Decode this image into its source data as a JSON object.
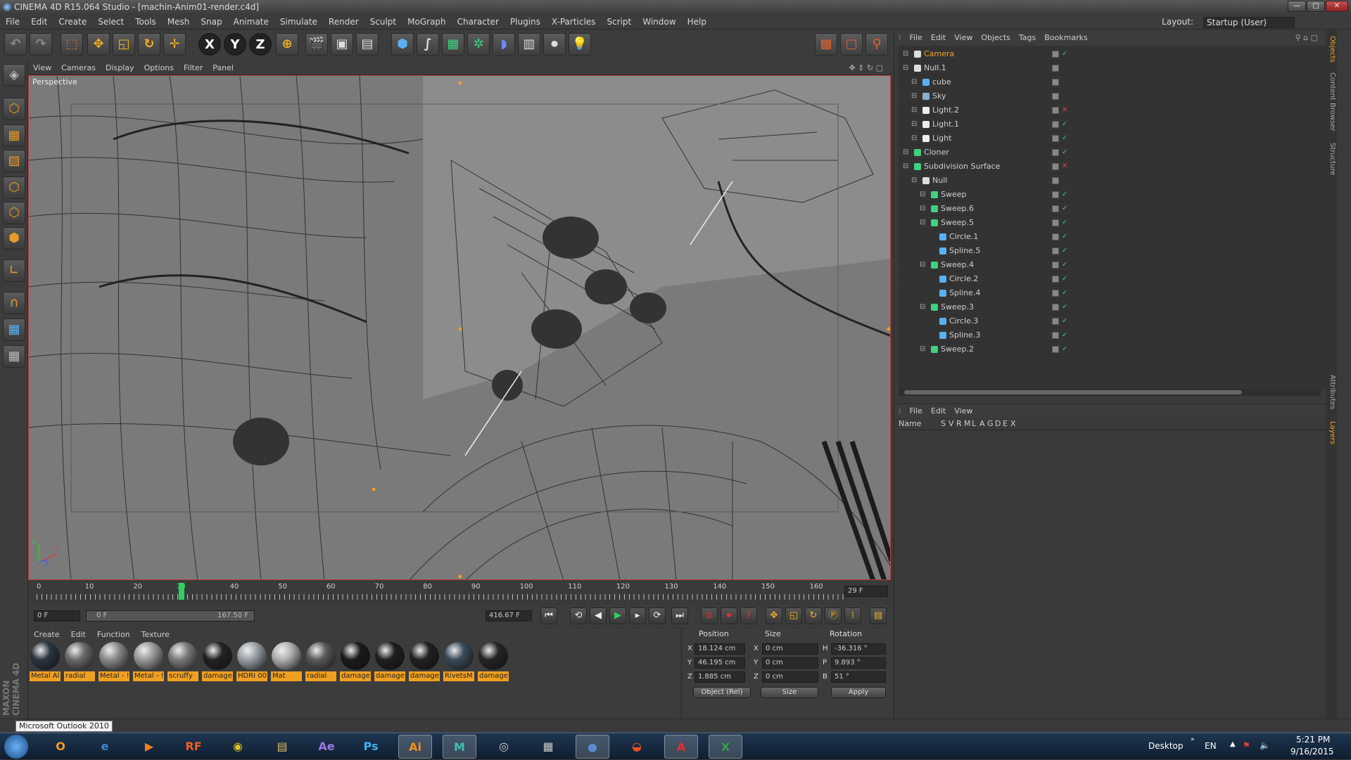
{
  "window": {
    "title": "CINEMA 4D R15.064 Studio - [machin-Anim01-render.c4d]",
    "buttons": [
      "—",
      "□",
      "✕"
    ]
  },
  "menubar": {
    "items": [
      "File",
      "Edit",
      "Create",
      "Select",
      "Tools",
      "Mesh",
      "Snap",
      "Animate",
      "Simulate",
      "Render",
      "Sculpt",
      "MoGraph",
      "Character",
      "Plugins",
      "X-Particles",
      "Script",
      "Window",
      "Help"
    ],
    "layout_label": "Layout:",
    "layout_value": "Startup (User)"
  },
  "toolbar": {
    "axis_labels": [
      "X",
      "Y",
      "Z"
    ]
  },
  "viewport": {
    "menu": [
      "View",
      "Cameras",
      "Display",
      "Options",
      "Filter",
      "Panel"
    ],
    "label": "Perspective",
    "axis": [
      "X",
      "Y",
      "Z"
    ]
  },
  "timeline": {
    "ticks": [
      "0",
      "10",
      "20",
      "29",
      "40",
      "50",
      "60",
      "70",
      "80",
      "90",
      "100",
      "110",
      "120",
      "130",
      "140",
      "150",
      "160"
    ],
    "current_frame": "29",
    "end_frame_display": "29 F",
    "playhead": 0.176
  },
  "transport": {
    "start": "0 F",
    "range_start": "0 F",
    "range_end": "167.50 F",
    "end": "416.67 F"
  },
  "materials": {
    "menu": [
      "Create",
      "Edit",
      "Function",
      "Texture"
    ],
    "items": [
      {
        "label": "Metal Al",
        "color": "#2a3540"
      },
      {
        "label": "radial",
        "color": "#6a6a6a"
      },
      {
        "label": "Metal - !",
        "color": "#8a8a8a"
      },
      {
        "label": "Metal - !",
        "color": "#9a9a9a"
      },
      {
        "label": "scruffy",
        "color": "#7a7a7a"
      },
      {
        "label": "damage",
        "color": "#222222"
      },
      {
        "label": "HDRI 00",
        "color": "#9aa0a6"
      },
      {
        "label": "Mat",
        "color": "#b0b0b0"
      },
      {
        "label": "radial",
        "color": "#5a5a5a"
      },
      {
        "label": "damage",
        "color": "#1a1a1a"
      },
      {
        "label": "damage",
        "color": "#1e1e1e"
      },
      {
        "label": "damage",
        "color": "#202020"
      },
      {
        "label": "RivetsM",
        "color": "#3a4a58"
      },
      {
        "label": "damage",
        "color": "#242424"
      }
    ]
  },
  "coordinates": {
    "headers": [
      "Position",
      "Size",
      "Rotation"
    ],
    "rows": [
      {
        "axis": "X",
        "pos": "18.124 cm",
        "size_axis": "X",
        "size": "0 cm",
        "rot_axis": "H",
        "rot": "-36.316 °"
      },
      {
        "axis": "Y",
        "pos": "46.195 cm",
        "size_axis": "Y",
        "size": "0 cm",
        "rot_axis": "P",
        "rot": "9.893 °"
      },
      {
        "axis": "Z",
        "pos": "1.885 cm",
        "size_axis": "Z",
        "size": "0 cm",
        "rot_axis": "B",
        "rot": "51 °"
      }
    ],
    "mode": "Object (Rel)",
    "size_mode": "Size",
    "apply": "Apply"
  },
  "object_manager": {
    "menu": [
      "File",
      "Edit",
      "View",
      "Objects",
      "Tags",
      "Bookmarks"
    ],
    "objects": [
      {
        "name": "Camera",
        "depth": 0,
        "color": "#f0a020",
        "icon": "camera-icon",
        "vis": "✓"
      },
      {
        "name": "Null.1",
        "depth": 0,
        "color": "#cfcfcf",
        "icon": "null-icon",
        "vis": ""
      },
      {
        "name": "cube",
        "depth": 1,
        "color": "#cfcfcf",
        "icon": "cube-icon",
        "vis": ""
      },
      {
        "name": "Sky",
        "depth": 1,
        "color": "#cfcfcf",
        "icon": "sky-icon",
        "vis": ""
      },
      {
        "name": "Light.2",
        "depth": 1,
        "color": "#cfcfcf",
        "icon": "light-icon",
        "vis": "✕"
      },
      {
        "name": "Light.1",
        "depth": 1,
        "color": "#cfcfcf",
        "icon": "light-icon",
        "vis": "✓"
      },
      {
        "name": "Light",
        "depth": 1,
        "color": "#cfcfcf",
        "icon": "light-icon",
        "vis": "✓"
      },
      {
        "name": "Cloner",
        "depth": 0,
        "color": "#cfcfcf",
        "icon": "cloner-icon",
        "vis": "✓"
      },
      {
        "name": "Subdivision Surface",
        "depth": 0,
        "color": "#cfcfcf",
        "icon": "subdivision-icon",
        "vis": "✕"
      },
      {
        "name": "Null",
        "depth": 1,
        "color": "#cfcfcf",
        "icon": "null-icon",
        "vis": ""
      },
      {
        "name": "Sweep",
        "depth": 2,
        "color": "#cfcfcf",
        "icon": "sweep-icon",
        "vis": "✓"
      },
      {
        "name": "Sweep.6",
        "depth": 2,
        "color": "#cfcfcf",
        "icon": "sweep-icon",
        "vis": "✓"
      },
      {
        "name": "Sweep.5",
        "depth": 2,
        "color": "#cfcfcf",
        "icon": "sweep-icon",
        "vis": "✓"
      },
      {
        "name": "Circle.1",
        "depth": 3,
        "color": "#cfcfcf",
        "icon": "circle-icon",
        "vis": "✓"
      },
      {
        "name": "Spline.5",
        "depth": 3,
        "color": "#cfcfcf",
        "icon": "spline-icon",
        "vis": "✓"
      },
      {
        "name": "Sweep.4",
        "depth": 2,
        "color": "#cfcfcf",
        "icon": "sweep-icon",
        "vis": "✓"
      },
      {
        "name": "Circle.2",
        "depth": 3,
        "color": "#cfcfcf",
        "icon": "circle-icon",
        "vis": "✓"
      },
      {
        "name": "Spline.4",
        "depth": 3,
        "color": "#cfcfcf",
        "icon": "spline-icon",
        "vis": "✓"
      },
      {
        "name": "Sweep.3",
        "depth": 2,
        "color": "#cfcfcf",
        "icon": "sweep-icon",
        "vis": "✓"
      },
      {
        "name": "Circle.3",
        "depth": 3,
        "color": "#cfcfcf",
        "icon": "circle-icon",
        "vis": "✓"
      },
      {
        "name": "Spline.3",
        "depth": 3,
        "color": "#cfcfcf",
        "icon": "spline-icon",
        "vis": "✓"
      },
      {
        "name": "Sweep.2",
        "depth": 2,
        "color": "#cfcfcf",
        "icon": "sweep-icon",
        "vis": "✓"
      }
    ]
  },
  "attributes": {
    "menu": [
      "File",
      "Edit",
      "View"
    ],
    "columns": [
      "Name",
      "S",
      "V",
      "R",
      "M",
      "L",
      "A",
      "G",
      "D",
      "E",
      "X"
    ]
  },
  "side_tabs": [
    "Objects",
    "Content Browser",
    "Structure",
    "Attributes",
    "Layers"
  ],
  "statusbar": {
    "tooltip": "Microsoft Outlook 2010",
    "brand": "MAXON CINEMA 4D"
  },
  "taskbar": {
    "apps": [
      {
        "label": "",
        "icon": "start-orb-icon"
      },
      {
        "label": "O",
        "icon": "outlook-icon"
      },
      {
        "label": "e",
        "icon": "ie-icon"
      },
      {
        "label": "▶",
        "icon": "media-player-icon"
      },
      {
        "label": "RF",
        "icon": "realflow-icon"
      },
      {
        "label": "◉",
        "icon": "chrome-icon"
      },
      {
        "label": "▤",
        "icon": "explorer-icon"
      },
      {
        "label": "Ae",
        "icon": "after-effects-icon"
      },
      {
        "label": "Ps",
        "icon": "photoshop-icon"
      },
      {
        "label": "Ai",
        "icon": "illustrator-icon"
      },
      {
        "label": "M",
        "icon": "maya-icon"
      },
      {
        "label": "◎",
        "icon": "steam-icon"
      },
      {
        "label": "▦",
        "icon": "unity-icon"
      },
      {
        "label": "●",
        "icon": "cinema4d-icon"
      },
      {
        "label": "◒",
        "icon": "houdini-icon"
      },
      {
        "label": "A",
        "icon": "acrobat-icon"
      },
      {
        "label": "X",
        "icon": "excel-icon"
      }
    ],
    "desktop": "Desktop",
    "lang": "EN",
    "time": "5:21 PM",
    "date": "9/16/2015"
  }
}
